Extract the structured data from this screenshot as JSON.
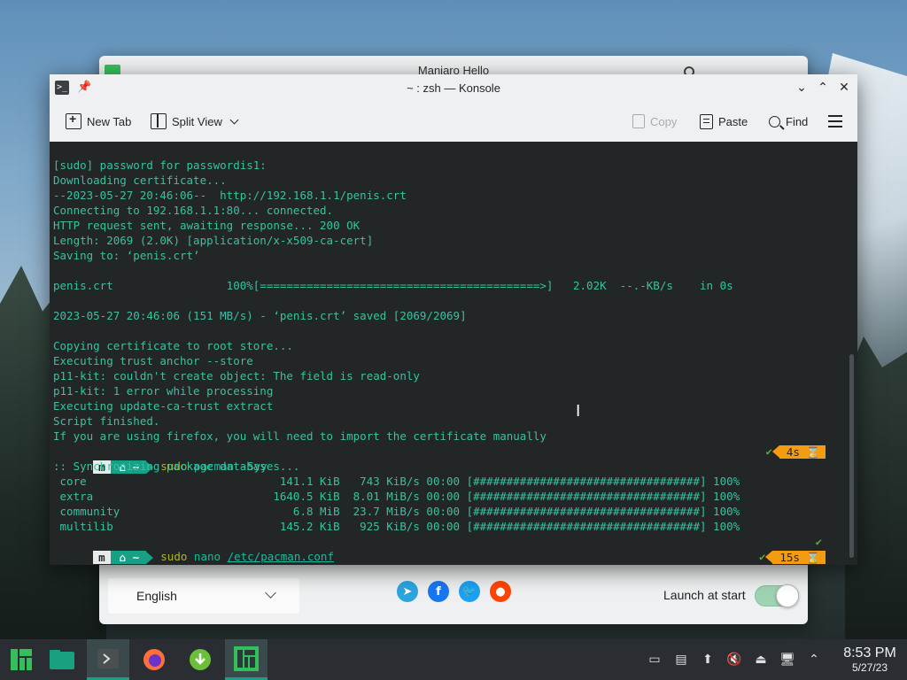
{
  "hello_window": {
    "title": "Maniaro Hello",
    "language": "English",
    "launch_label": "Launch at start",
    "launch_enabled": true,
    "socials": [
      {
        "name": "telegram-icon",
        "glyph": "➤",
        "color": "#2ca5e0"
      },
      {
        "name": "facebook-icon",
        "glyph": "f",
        "color": "#1877f2"
      },
      {
        "name": "twitter-icon",
        "glyph": "🐦",
        "color": "#1da1f2"
      },
      {
        "name": "reddit-icon",
        "glyph": "●",
        "color": "#ff4500"
      }
    ]
  },
  "konsole": {
    "title": "~ : zsh — Konsole",
    "toolbar": {
      "new_tab": "New Tab",
      "split_view": "Split View",
      "copy": "Copy",
      "paste": "Paste",
      "find": "Find"
    },
    "output_lines": [
      "[sudo] password for passwordis1:",
      "Downloading certificate...",
      "--2023-05-27 20:46:06--  http://192.168.1.1/penis.crt",
      "Connecting to 192.168.1.1:80... connected.",
      "HTTP request sent, awaiting response... 200 OK",
      "Length: 2069 (2.0K) [application/x-x509-ca-cert]",
      "Saving to: ‘penis.crt’",
      "",
      "penis.crt                 100%[==========================================>]   2.02K  --.-KB/s    in 0s",
      "",
      "2023-05-27 20:46:06 (151 MB/s) - ‘penis.crt’ saved [2069/2069]",
      "",
      "Copying certificate to root store...",
      "Executing trust anchor --store",
      "p11-kit: couldn't create object: The field is read-only",
      "p11-kit: 1 error while processing",
      "Executing update-ca-trust extract",
      "Script finished.",
      "If you are using firefox, you will need to import the certificate manually"
    ],
    "prompt1": {
      "home": "~",
      "sudo": "sudo",
      "cmd": "pacman",
      "args": " -Syy",
      "check": "✔",
      "time": "4s ⌛"
    },
    "sync_lines": [
      ":: Synchronizing package databases...",
      " core                             141.1 KiB   743 KiB/s 00:00 [##################################] 100%",
      " extra                           1640.5 KiB  8.01 MiB/s 00:00 [##################################] 100%",
      " community                          6.8 MiB  23.7 MiB/s 00:00 [##################################] 100%",
      " multilib                         145.2 KiB   925 KiB/s 00:00 [##################################] 100%"
    ],
    "prompt2": {
      "home": "~",
      "sudo": "sudo",
      "cmd": "nano",
      "path": "/etc/pacman.conf",
      "check": "✔"
    },
    "prompt3": {
      "home": "~",
      "check": "✔",
      "time": "15s ⌛"
    }
  },
  "taskbar": {
    "apps": [
      {
        "name": "manjaro-menu-icon",
        "active": false
      },
      {
        "name": "file-manager-icon",
        "active": false
      },
      {
        "name": "konsole-icon",
        "active": true
      },
      {
        "name": "firefox-icon",
        "active": false
      },
      {
        "name": "downloader-icon",
        "active": false
      },
      {
        "name": "manjaro-hello-icon",
        "active": true
      }
    ],
    "time": "8:53 PM",
    "date": "5/27/23"
  }
}
